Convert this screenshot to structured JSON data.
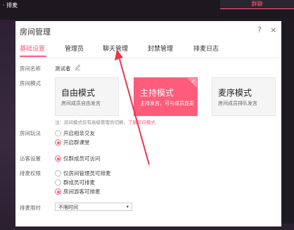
{
  "backdrop": {
    "top_left_text": "· 排麦",
    "top_right_tab": "群聊"
  },
  "dialog": {
    "title": "房间管理",
    "window_buttons": {
      "help": "?",
      "close": "×"
    },
    "tabs": [
      "基础设置",
      "管理员",
      "聊天管理",
      "封禁管理",
      "排麦日志"
    ],
    "active_tab": "基础设置",
    "room_name": {
      "label": "房间名称",
      "value": "测试者"
    },
    "room_mode": {
      "label": "房间模式",
      "modes": [
        {
          "title": "自由模式",
          "desc": "房间成员自由发言"
        },
        {
          "title": "主持模式",
          "desc": "主持发言，可与成员连麦"
        },
        {
          "title": "麦序模式",
          "desc": "房间成员排队发言"
        }
      ],
      "selected": "主持模式",
      "note_prefix": "注：房间模式仅有高级管理员切换，",
      "note_link": "了解房间模式"
    },
    "room_play": {
      "label": "房间玩法",
      "options": [
        "开启相亲交友",
        "开启群课堂"
      ],
      "selected": "开启群课堂"
    },
    "visitor": {
      "label": "访客设置",
      "options": [
        "仅群成员可访问"
      ],
      "selected": "仅群成员可访问"
    },
    "queue_permission": {
      "label": "排麦权限",
      "options": [
        "仅房间管理员可排麦",
        "群成员可排麦",
        "房间游客可排麦"
      ],
      "selected": "房间游客可排麦"
    },
    "queue_time": {
      "label": "排麦限时",
      "value": "不限时间"
    }
  },
  "colors": {
    "accent": "#ff5b7a",
    "annotation_arrow": "#e8384f"
  }
}
